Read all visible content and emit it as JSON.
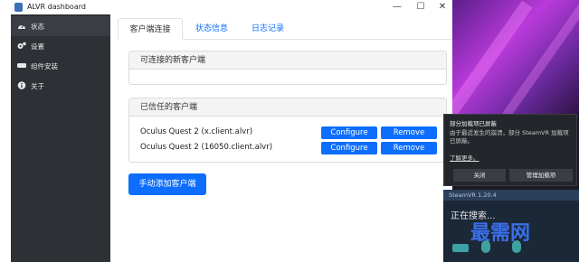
{
  "window": {
    "title": "ALVR dashboard",
    "minimize_icon": "—",
    "maximize_icon": "☐",
    "close_icon": "✕"
  },
  "sidebar": {
    "items": [
      {
        "label": "状态",
        "icon": "dashboard-icon"
      },
      {
        "label": "设置",
        "icon": "gears-icon"
      },
      {
        "label": "组件安装",
        "icon": "headset-icon"
      },
      {
        "label": "关于",
        "icon": "info-icon"
      }
    ]
  },
  "tabs": [
    {
      "label": "客户端连接",
      "active": true
    },
    {
      "label": "状态信息",
      "active": false
    },
    {
      "label": "日志记录",
      "active": false
    }
  ],
  "new_clients": {
    "header": "可连接的新客户端"
  },
  "trusted_clients": {
    "header": "已信任的客户端",
    "rows": [
      {
        "name": "Oculus Quest 2 (x.client.alvr)",
        "configure": "Configure",
        "remove": "Remove"
      },
      {
        "name": "Oculus Quest 2 (16050.client.alvr)",
        "configure": "Configure",
        "remove": "Remove"
      }
    ]
  },
  "add_client_label": "手动添加客户端",
  "notification": {
    "title": "部分加载项已屏蔽",
    "description": "由于最近发生的崩溃，部分 SteamVR 加载项已屏蔽。",
    "more": "了解更多。",
    "close_label": "关闭",
    "manage_label": "管理加载项"
  },
  "steamvr": {
    "header": "SteamVR 1.20.4",
    "status": "正在搜索...",
    "watermark": "最需网"
  },
  "colors": {
    "primary": "#0d6efd",
    "sidebar": "#2d3035"
  }
}
